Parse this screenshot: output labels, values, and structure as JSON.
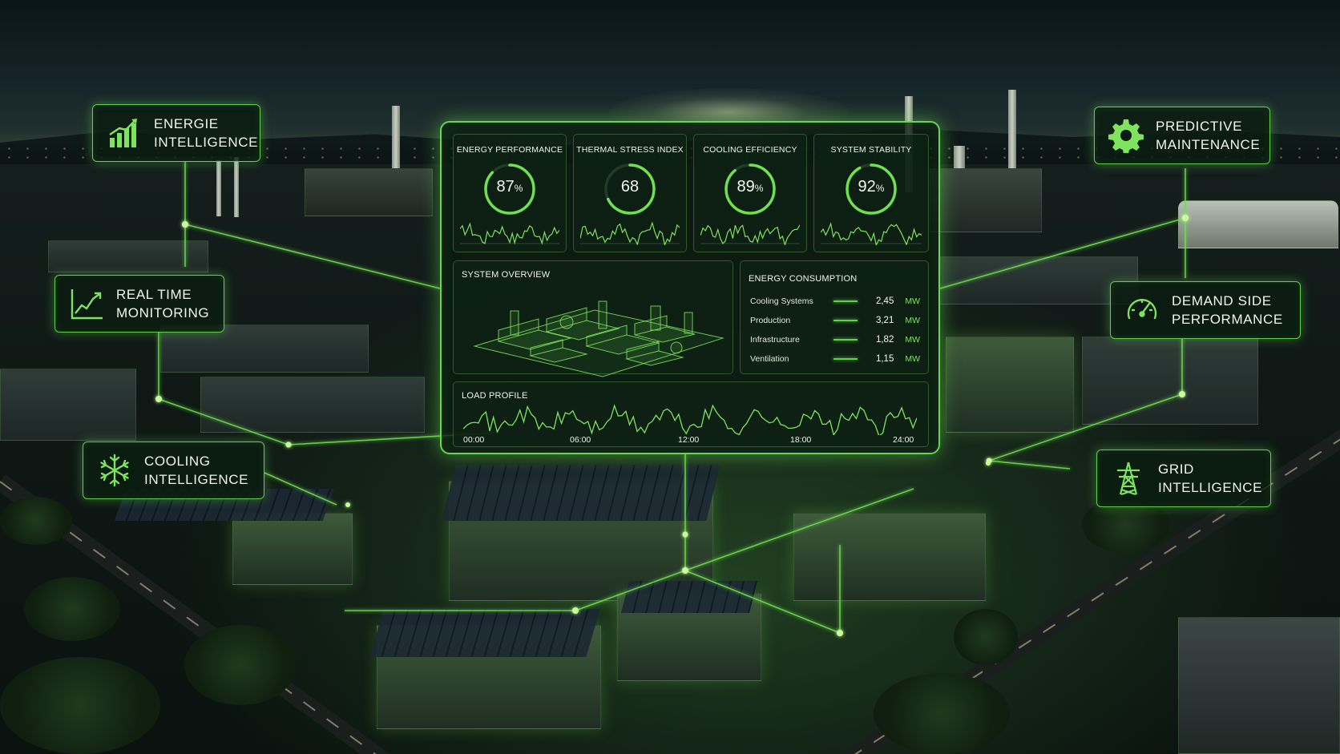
{
  "callouts": {
    "energie": {
      "label": "ENERGIE\nINTELLIGENCE",
      "icon": "bar-chart-icon"
    },
    "realtime": {
      "label": "REAL TIME\nMONITORING",
      "icon": "trend-line-icon"
    },
    "cooling": {
      "label": "COOLING\nINTELLIGENCE",
      "icon": "snowflake-icon"
    },
    "predictive": {
      "label": "PREDICTIVE\nMAINTENANCE",
      "icon": "gear-icon"
    },
    "demand": {
      "label": "DEMAND SIDE\nPERFORMANCE",
      "icon": "speedometer-icon"
    },
    "grid": {
      "label": "GRID\nINTELLIGENCE",
      "icon": "power-tower-icon"
    }
  },
  "dashboard": {
    "kpis": [
      {
        "title": "ENERGY PERFORMANCE",
        "value": "87",
        "unit": "%",
        "level": 0.87
      },
      {
        "title": "THERMAL STRESS INDEX",
        "value": "68",
        "unit": "",
        "level": 0.68
      },
      {
        "title": "COOLING EFFICIENCY",
        "value": "89",
        "unit": "%",
        "level": 0.89
      },
      {
        "title": "SYSTEM STABILITY",
        "value": "92",
        "unit": "%",
        "level": 0.92
      }
    ],
    "overview": {
      "title": "SYSTEM OVERVIEW"
    },
    "consumption": {
      "title": "ENERGY CONSUMPTION",
      "rows": [
        {
          "name": "Cooling Systems",
          "value": "2,45",
          "unit": "MW"
        },
        {
          "name": "Production",
          "value": "3,21",
          "unit": "MW"
        },
        {
          "name": "Infrastructure",
          "value": "1,82",
          "unit": "MW"
        },
        {
          "name": "Ventilation",
          "value": "1,15",
          "unit": "MW"
        }
      ]
    },
    "load_profile": {
      "title": "LOAD PROFILE",
      "ticks": [
        "00:00",
        "06:00",
        "12:00",
        "18:00",
        "24:00"
      ]
    }
  },
  "colors": {
    "accent": "#5fd04a",
    "panel": "#0a1a10"
  }
}
